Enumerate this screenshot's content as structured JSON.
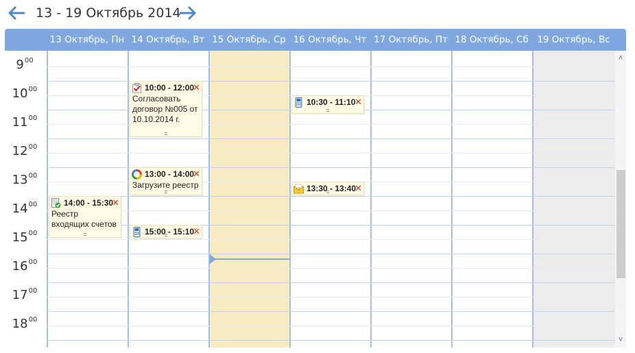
{
  "nav": {
    "range_title": "13 - 19 Октябрь 2014"
  },
  "days": [
    {
      "label": "13 Октябрь, Пн"
    },
    {
      "label": "14 Октябрь, Вт"
    },
    {
      "label": "15 Октябрь, Ср"
    },
    {
      "label": "16 Октябрь, Чт"
    },
    {
      "label": "17 Октябрь, Пт"
    },
    {
      "label": "18 Октябрь, Сб"
    },
    {
      "label": "19 Октябрь, Вс"
    }
  ],
  "hours": [
    {
      "h": "9",
      "m": "00"
    },
    {
      "h": "10",
      "m": "00"
    },
    {
      "h": "11",
      "m": "00"
    },
    {
      "h": "12",
      "m": "00"
    },
    {
      "h": "13",
      "m": "00"
    },
    {
      "h": "14",
      "m": "00"
    },
    {
      "h": "15",
      "m": "00"
    },
    {
      "h": "16",
      "m": "00"
    },
    {
      "h": "17",
      "m": "00"
    },
    {
      "h": "18",
      "m": "00"
    }
  ],
  "events": [
    {
      "time": "10:00 - 12:00",
      "text": "Согласовать договор №005 от 10.10.2014 г.",
      "icon": "task-check-icon"
    },
    {
      "time": "13:00 - 14:00",
      "text": "Загрузите реестр",
      "icon": "refresh-circle-icon"
    },
    {
      "time": "15:00 - 15:10",
      "text": "",
      "icon": "phone-icon"
    },
    {
      "time": "14:00 - 15:30",
      "text": "Реестр входящих счетов",
      "icon": "document-check-icon"
    },
    {
      "time": "10:30 - 11:10",
      "text": "",
      "icon": "phone-icon"
    },
    {
      "time": "13:30 - 13:40",
      "text": "",
      "icon": "envelope-icon"
    }
  ],
  "colors": {
    "accent": "#7fa8e1",
    "today_bg": "#faecc2",
    "weekend_bg": "#ececec",
    "event_bg": "#fffbe4",
    "close": "#e0321e"
  }
}
